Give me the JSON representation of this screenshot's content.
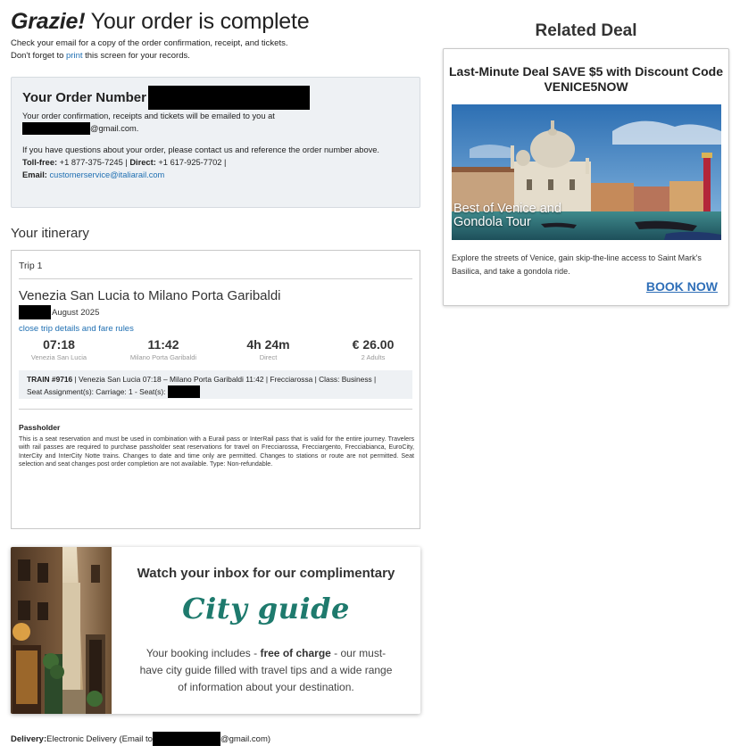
{
  "header": {
    "title_emphasis": "Grazie!",
    "title_rest": " Your order is complete",
    "intro_line1": "Check your email for a copy of the order confirmation, receipt, and tickets.",
    "intro_line2_pre": "Don't forget to ",
    "intro_print_link": "print",
    "intro_line2_post": " this screen for your records."
  },
  "order": {
    "title": "Your Order Number",
    "email_line": "Your order confirmation, receipts and tickets will be emailed to you at",
    "email_domain": "@gmail.com.",
    "questions": "If you have questions about your order, please contact us and reference the order number above.",
    "tollfree_label": "Toll-free:",
    "tollfree_value": " +1 877-375-7245 | ",
    "direct_label": "Direct:",
    "direct_value": " +1 617-925-7702 |",
    "email_label": "Email:",
    "email_value": "customerservice@italiarail.com"
  },
  "itinerary": {
    "title": "Your itinerary",
    "trip_label": "Trip 1",
    "route": "Venezia San Lucia to Milano Porta Garibaldi",
    "date_suffix": "August 2025",
    "fare_link": "close trip details and fare rules",
    "segments": [
      {
        "value": "07:18",
        "sub": "Venezia San Lucia"
      },
      {
        "value": "11:42",
        "sub": "Milano Porta Garibaldi"
      },
      {
        "value": "4h 24m",
        "sub": "Direct"
      },
      {
        "value": "€ 26.00",
        "sub": "2 Adults"
      }
    ],
    "train_label": "TRAIN #9716",
    "train_details": " | Venezia San Lucia 07:18 – Milano Porta Garibaldi 11:42 | Frecciarossa | Class: Business |",
    "seat_label": "Seat Assignment(s): Carriage: 1 - Seat(s):",
    "passholder_title": "Passholder",
    "passholder_text": "This is a seat reservation and must be used in combination with a Eurail pass or InterRail pass that is valid for the entire journey. Travelers with rail passes are required to purchase passholder seat reservations for travel on Frecciarossa, Frecciargento, Frecciabianca, EuroCity, InterCity and InterCity Notte trains. Changes to date and time only are permitted. Changes to stations or route are not permitted. Seat selection and seat changes post order completion are not available. Type: Non-refundable."
  },
  "guide": {
    "heading": "Watch your inbox for our complimentary",
    "script": "City guide",
    "body_pre": "Your booking includes - ",
    "body_bold": "free of charge",
    "body_post": " - our must-have city guide filled with travel tips and a wide range of information about your destination."
  },
  "delivery": {
    "label": "Delivery:",
    "value_pre": " Electronic Delivery (Email to ",
    "value_post": "@gmail.com)"
  },
  "related": {
    "title": "Related Deal",
    "deal_title": "Last-Minute Deal SAVE $5 with Discount Code VENICE5NOW",
    "photo_caption": "Best of Venice and Gondola Tour",
    "description": "Explore the streets of Venice, gain skip-the-line access to Saint Mark's Basilica, and take a gondola ride.",
    "cta": "BOOK NOW"
  },
  "colors": {
    "link": "#1f6fb2",
    "order_box_bg": "#eef1f4",
    "script_green": "#1e7a6d",
    "cta_blue": "#2f6fb8"
  }
}
